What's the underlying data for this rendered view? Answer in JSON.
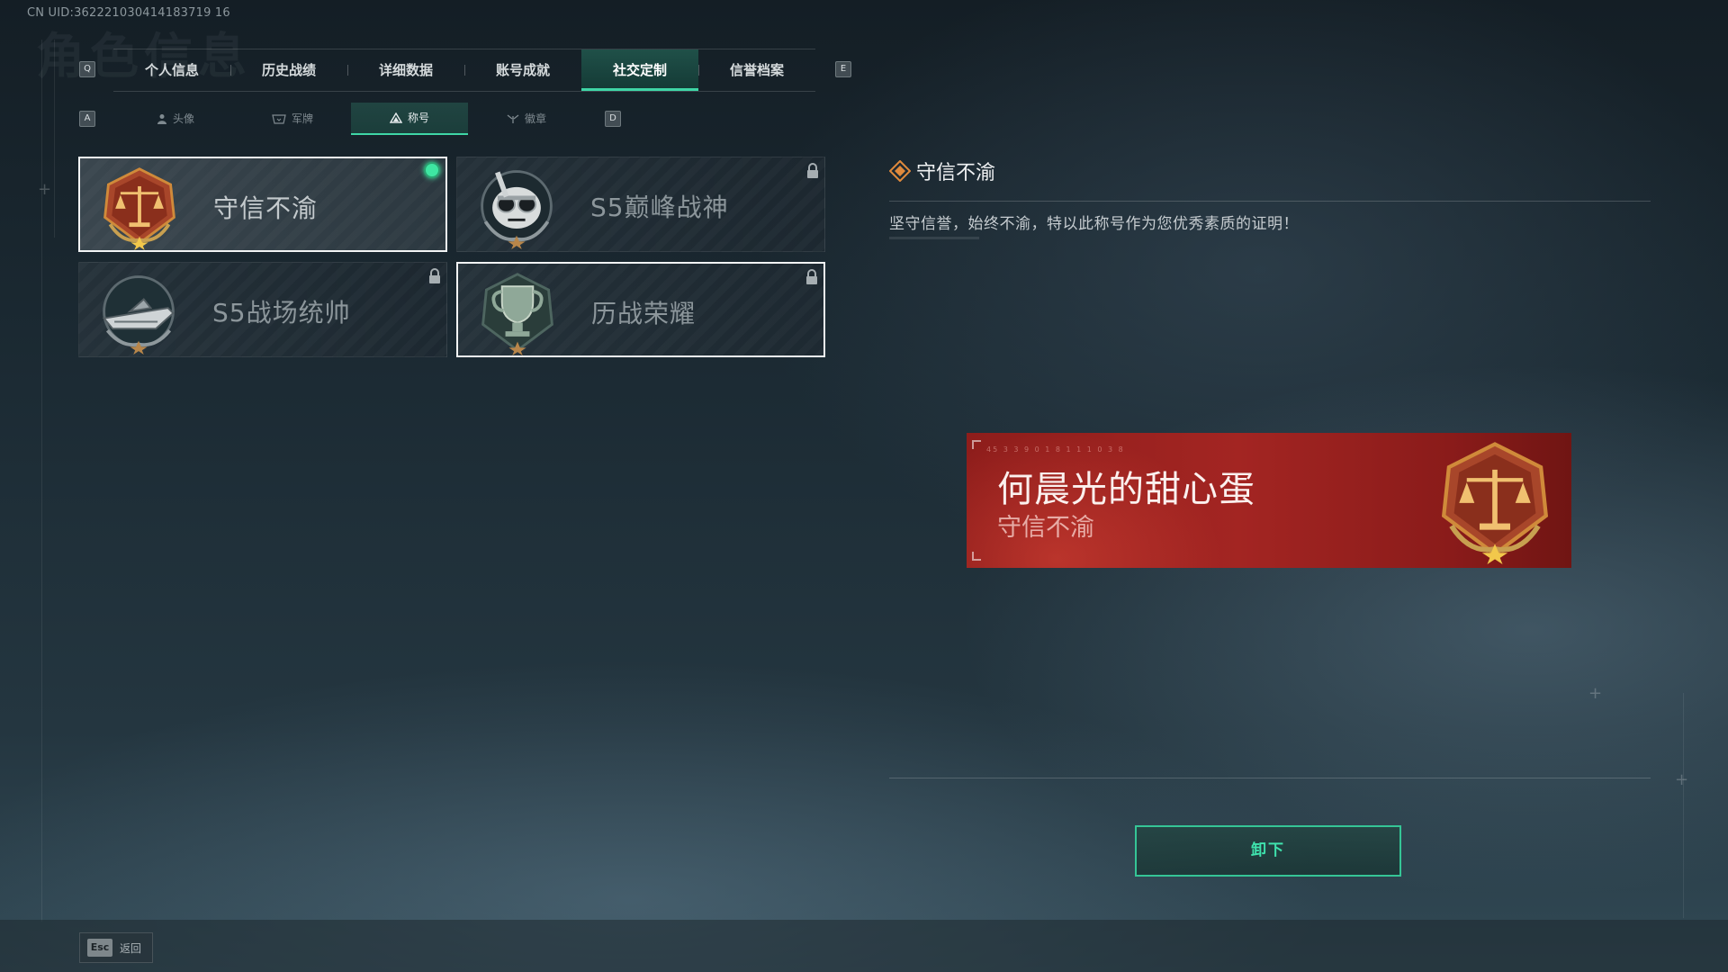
{
  "uid_text": "CN UID:362221030414183719 16",
  "ghost_title": "角色信息",
  "main_tabs": {
    "prev_key": "Q",
    "next_key": "E",
    "items": [
      {
        "label": "个人信息"
      },
      {
        "label": "历史战绩"
      },
      {
        "label": "详细数据"
      },
      {
        "label": "账号成就"
      },
      {
        "label": "社交定制",
        "active": true
      },
      {
        "label": "信誉档案"
      }
    ]
  },
  "sub_tabs": {
    "prev_key": "A",
    "next_key": "D",
    "items": [
      {
        "label": "头像",
        "icon": "person-icon"
      },
      {
        "label": "军牌",
        "icon": "dogtag-icon"
      },
      {
        "label": "称号",
        "icon": "triangle-badge-icon",
        "active": true
      },
      {
        "label": "徽章",
        "icon": "wings-icon"
      }
    ]
  },
  "titles": [
    {
      "name": "守信不渝",
      "emblem": "scales-of-justice-emblem",
      "state": "equipped",
      "locked": false
    },
    {
      "name": "S5巅峰战神",
      "emblem": "skull-goggles-emblem",
      "state": "locked",
      "locked": true
    },
    {
      "name": "S5战场统帅",
      "emblem": "speedboat-emblem",
      "state": "locked",
      "locked": true
    },
    {
      "name": "历战荣耀",
      "emblem": "trophy-emblem",
      "state": "locked-outlined",
      "locked": true
    }
  ],
  "detail": {
    "title": "守信不渝",
    "description": "坚守信誉，始终不渝，特以此称号作为您优秀素质的证明！"
  },
  "banner": {
    "player_name": "何晨光的甜心蛋",
    "title": "守信不渝",
    "tiny_code": "45 3 3 9 0 1   8 1 1 1 0 3 8",
    "color": "#a32522"
  },
  "action_button": {
    "label": "卸下",
    "color": "#3fe2ad"
  },
  "footer": {
    "esc_key": "Esc",
    "esc_label": "返回"
  },
  "colors": {
    "accent": "#3fd6a6",
    "equipped_dot": "#3ee6a2"
  }
}
